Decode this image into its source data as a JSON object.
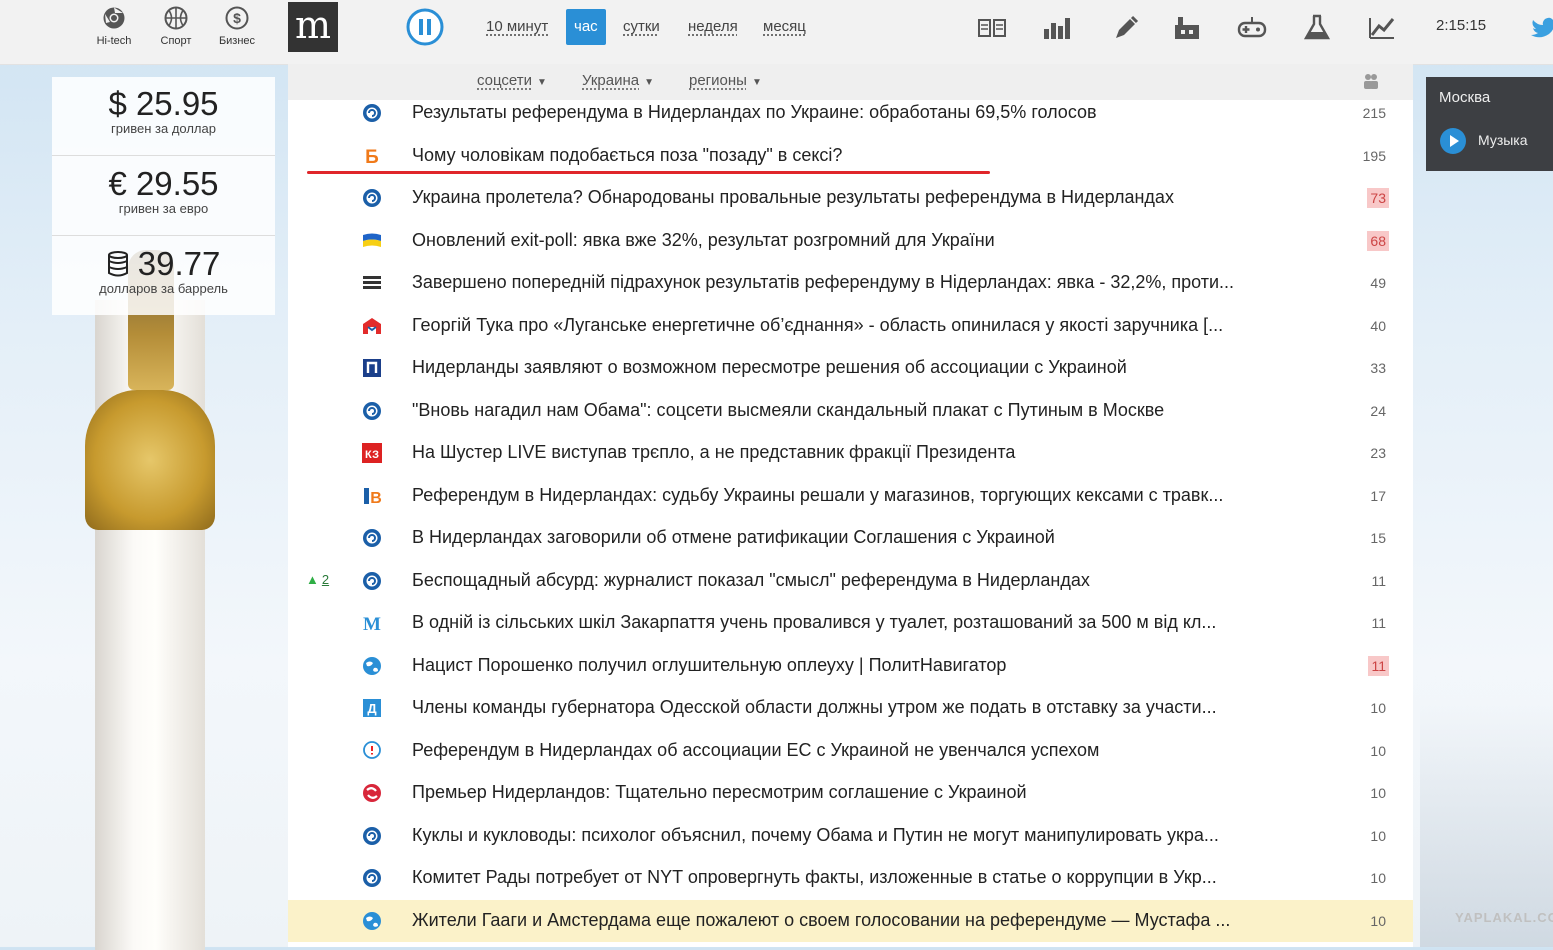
{
  "categories": [
    {
      "label": "Hi-tech",
      "icon": "chrome-icon"
    },
    {
      "label": "Спорт",
      "icon": "basketball-icon"
    },
    {
      "label": "Бизнес",
      "icon": "dollar-icon"
    }
  ],
  "logo": {
    "text": "m"
  },
  "periods": [
    {
      "label": "10 минут",
      "active": false
    },
    {
      "label": "час",
      "active": true
    },
    {
      "label": "сутки",
      "active": false
    },
    {
      "label": "неделя",
      "active": false
    },
    {
      "label": "месяц",
      "active": false
    }
  ],
  "toolbar_icons": [
    "book-icon",
    "bar-chart-icon",
    "pen-icon",
    "factory-icon",
    "gamepad-icon",
    "flask-icon",
    "trend-chart-icon"
  ],
  "clock": "2:15:15",
  "rates": [
    {
      "value": "$ 25.95",
      "caption": "гривен за доллар"
    },
    {
      "value": "€ 29.55",
      "caption": "гривен за евро"
    },
    {
      "value": "39.77",
      "caption": "долларов за баррель"
    }
  ],
  "filters": [
    {
      "label": "соцсети"
    },
    {
      "label": "Украина"
    },
    {
      "label": "регионы"
    }
  ],
  "news": [
    {
      "title": "Результаты референдума в Нидерландах по Украине: обработаны 69,5% голосов",
      "count": "215",
      "hot": false,
      "source_icon": "globe-arrow-icon"
    },
    {
      "title": "Чому чоловікам подобається поза \"позаду\" в сексі?",
      "count": "195",
      "hot": false,
      "source_icon": "letter-b-icon"
    },
    {
      "title": "Украина пролетела? Обнародованы провальные результаты референдума в Нидерландах",
      "count": "73",
      "hot": true,
      "source_icon": "globe-arrow-icon"
    },
    {
      "title": "Оновлений exit-poll: явка вже 32%, результат розгромний для України",
      "count": "68",
      "hot": true,
      "source_icon": "ukraine-flag-icon"
    },
    {
      "title": "Завершено попередній підрахунок результатів референдуму в Нідерландах: явка - 32,2%, проти...",
      "count": "49",
      "hot": false,
      "source_icon": "stripes-icon"
    },
    {
      "title": "Георгій Тука про «Луганське енергетичне об’єднання» - область опинилася у якості заручника [...",
      "count": "40",
      "hot": false,
      "source_icon": "house-logo-icon"
    },
    {
      "title": "Нидерланды заявляют о возможном пересмотре решения об ассоциации с Украиной",
      "count": "33",
      "hot": false,
      "source_icon": "letter-p-icon"
    },
    {
      "title": "\"Вновь нагадил нам Обама\": соцсети высмеяли скандальный плакат с Путиным в Москве",
      "count": "24",
      "hot": false,
      "source_icon": "globe-arrow-icon"
    },
    {
      "title": "На Шустер LIVE виступав трєпло, а не представник фракції Президента",
      "count": "23",
      "hot": false,
      "source_icon": "kz-logo-icon"
    },
    {
      "title": "Референдум в Нидерландах: судьбу Украины решали у магазинов, торгующих кексами с травк...",
      "count": "17",
      "hot": false,
      "source_icon": "ib-logo-icon"
    },
    {
      "title": "В Нидерландах заговорили об отмене ратификации Соглашения с Украиной",
      "count": "15",
      "hot": false,
      "source_icon": "globe-arrow-icon"
    },
    {
      "title": "Беспощадный абсурд: журналист показал \"смысл\" референдума в Нидерландах",
      "count": "11",
      "hot": false,
      "source_icon": "globe-arrow-icon",
      "rise": "2"
    },
    {
      "title": "В одній із сільських шкіл Закарпаття учень провалився у туалет, розташований за 500 м від кл...",
      "count": "11",
      "hot": false,
      "source_icon": "letter-m-icon"
    },
    {
      "title": "Нацист Порошенко получил оглушительную оплеуху | ПолитНавигатор",
      "count": "11",
      "hot": true,
      "source_icon": "globe-icon"
    },
    {
      "title": "Члены команды губернатора Одесской области должны утром же подать в отставку за участи...",
      "count": "10",
      "hot": false,
      "source_icon": "letter-d-icon"
    },
    {
      "title": "Референдум в Нидерландах об ассоциации ЕС с Украиной не увенчался успехом",
      "count": "10",
      "hot": false,
      "source_icon": "speech-bubble-icon"
    },
    {
      "title": "Премьер Нидерландов: Тщательно пересмотрим соглашение с Украиной",
      "count": "10",
      "hot": false,
      "source_icon": "red-swirl-icon"
    },
    {
      "title": "Куклы и кукловоды: психолог объяснил, почему Обама и Путин не могут манипулировать укра...",
      "count": "10",
      "hot": false,
      "source_icon": "globe-arrow-icon"
    },
    {
      "title": "Комитет Рады потребует от NYT опровергнуть факты, изложенные в статье о коррупции в Укр...",
      "count": "10",
      "hot": false,
      "source_icon": "globe-arrow-icon"
    },
    {
      "title": "Жители Гааги и Амстердама еще пожалеют о своем голосовании на референдуме — Мустафа ...",
      "count": "10",
      "hot": false,
      "source_icon": "globe-icon",
      "highlight": true
    }
  ],
  "right_widget": {
    "city": "Москва",
    "music_label": "Музыка"
  },
  "watermark": "YAPLAKAL.COM",
  "colors": {
    "accent": "#2a8fd6",
    "hot_badge": "#f8c8c8",
    "underline": "#e0262a",
    "highlight_row": "#fbf2c9"
  }
}
